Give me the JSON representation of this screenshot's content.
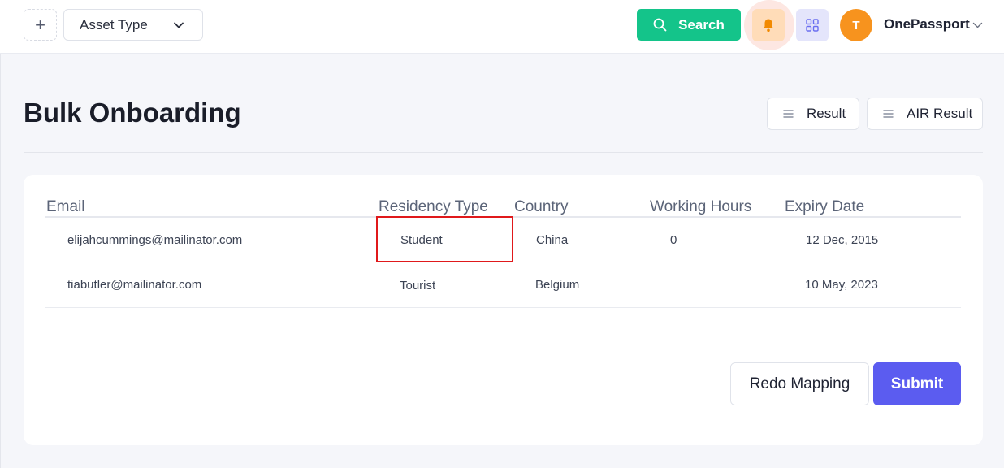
{
  "header": {
    "asset_select_value": "Asset Type",
    "search_label": "Search",
    "avatar_initial": "T",
    "user_name": "OnePassport"
  },
  "page": {
    "title": "Bulk Onboarding",
    "result_label": "Result",
    "air_result_label": "AIR Result"
  },
  "table": {
    "columns": [
      "Email",
      "Residency Type",
      "Country",
      "Working Hours",
      "Expiry Date"
    ],
    "rows": [
      [
        "elijahcummings@mailinator.com",
        "Student",
        "China",
        "0",
        "12 Dec, 2015"
      ],
      [
        "tiabutler@mailinator.com",
        "Tourist",
        "Belgium",
        "",
        "10 May, 2023"
      ]
    ]
  },
  "actions": {
    "redo_label": "Redo Mapping",
    "submit_label": "Submit"
  },
  "colors": {
    "search": "#14c48a",
    "submit": "#5b5cf0",
    "avatar": "#f7931e",
    "highlight": "#e0191b"
  },
  "icons": {
    "plus": "plus-icon",
    "chevron": "chevron-down-icon",
    "search": "search-icon",
    "bell": "bell-icon",
    "apps": "grid-icon",
    "menu": "menu-lines-icon"
  }
}
